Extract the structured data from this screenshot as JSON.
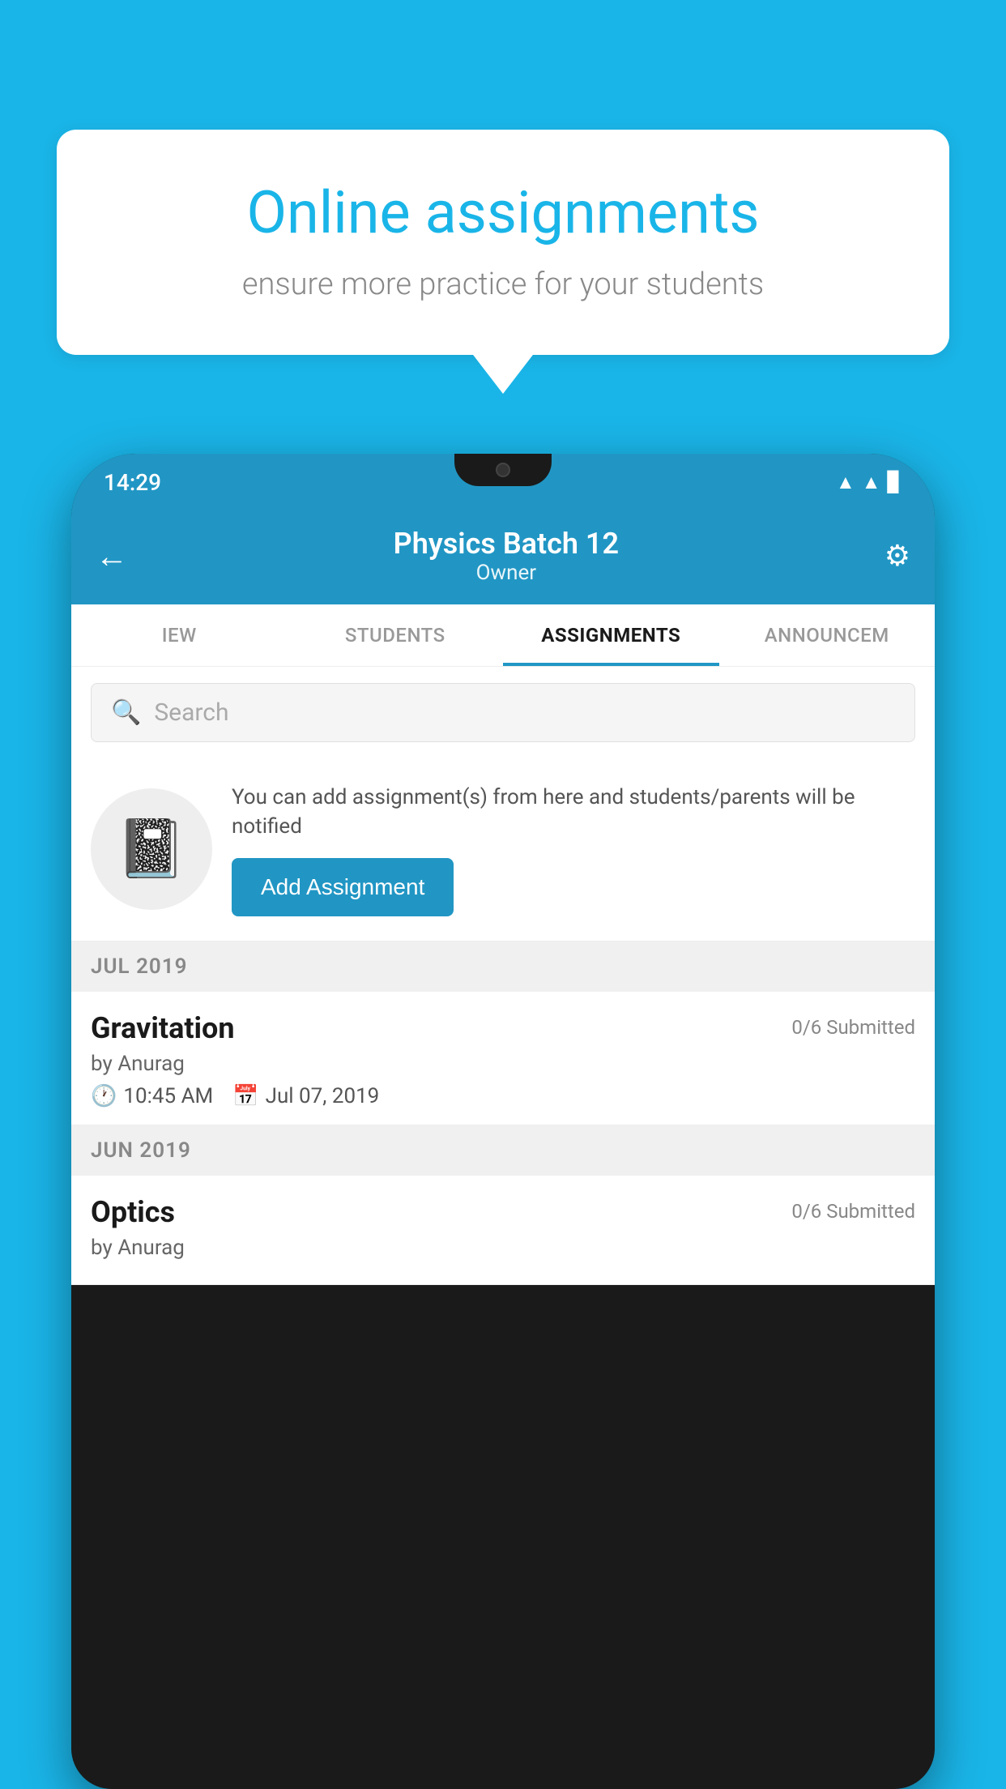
{
  "background": {
    "color": "#1ab5e8"
  },
  "speech_bubble": {
    "title": "Online assignments",
    "subtitle": "ensure more practice for your students"
  },
  "phone": {
    "status_bar": {
      "time": "14:29"
    },
    "header": {
      "title": "Physics Batch 12",
      "subtitle": "Owner",
      "back_label": "←",
      "settings_label": "⚙"
    },
    "tabs": [
      {
        "label": "IEW",
        "active": false
      },
      {
        "label": "STUDENTS",
        "active": false
      },
      {
        "label": "ASSIGNMENTS",
        "active": true
      },
      {
        "label": "ANNOUNCEM",
        "active": false
      }
    ],
    "search": {
      "placeholder": "Search"
    },
    "promo": {
      "text": "You can add assignment(s) from here and students/parents will be notified",
      "button_label": "Add Assignment"
    },
    "sections": [
      {
        "label": "JUL 2019",
        "assignments": [
          {
            "title": "Gravitation",
            "submitted": "0/6 Submitted",
            "by": "by Anurag",
            "time": "10:45 AM",
            "date": "Jul 07, 2019"
          }
        ]
      },
      {
        "label": "JUN 2019",
        "assignments": [
          {
            "title": "Optics",
            "submitted": "0/6 Submitted",
            "by": "by Anurag",
            "time": "",
            "date": ""
          }
        ]
      }
    ]
  }
}
